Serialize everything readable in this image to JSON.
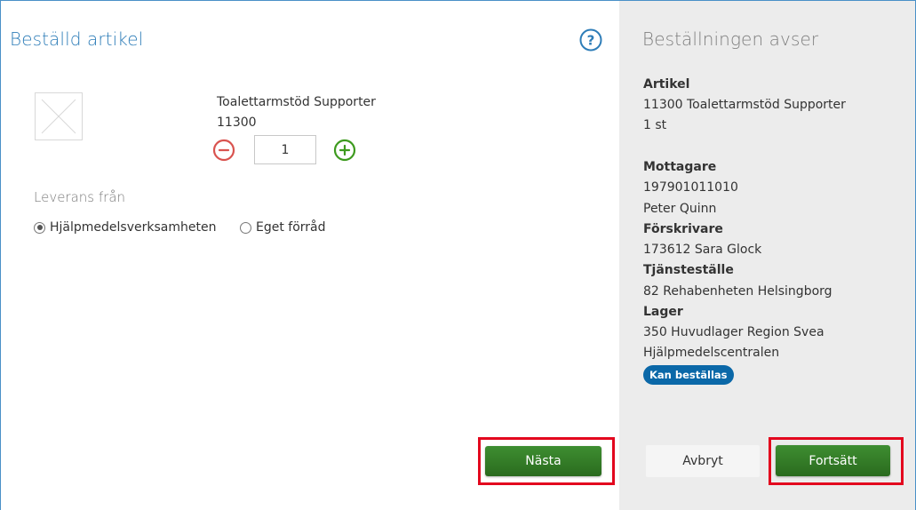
{
  "left_panel": {
    "title": "Beställd artikel",
    "article": {
      "name": "Toalettarmstöd Supporter",
      "number": "11300",
      "quantity": "1"
    },
    "delivery": {
      "label": "Leverans från",
      "options": [
        {
          "label": "Hjälpmedelsverksamheten",
          "selected": true
        },
        {
          "label": "Eget förråd",
          "selected": false
        }
      ]
    },
    "next_label": "Nästa"
  },
  "right_panel": {
    "title": "Beställningen avser",
    "artikel": {
      "heading": "Artikel",
      "line1": "11300 Toalettarmstöd Supporter",
      "line2": "1 st"
    },
    "mottagare": {
      "heading": "Mottagare",
      "line1": "197901011010",
      "line2": "Peter Quinn"
    },
    "forskrivare": {
      "heading": "Förskrivare",
      "line1": "173612 Sara Glock"
    },
    "tjanstestalle": {
      "heading": "Tjänsteställe",
      "line1": "82 Rehabenheten Helsingborg"
    },
    "lager": {
      "heading": "Lager",
      "line1": "350 Huvudlager Region Svea",
      "line2": "Hjälpmedelscentralen"
    },
    "status_badge": "Kan beställas",
    "cancel_label": "Avbryt",
    "continue_label": "Fortsätt"
  },
  "colors": {
    "accent_blue": "#2e7db8",
    "green_button": "#2f7425",
    "minus_red": "#d9534f",
    "plus_green": "#3d9a1e",
    "highlight_red": "#e3071e",
    "badge_blue": "#0b68a8"
  },
  "icons": {
    "help": "help-icon",
    "minus": "minus-circle-icon",
    "plus": "plus-circle-icon",
    "image_placeholder": "image-placeholder-icon"
  }
}
